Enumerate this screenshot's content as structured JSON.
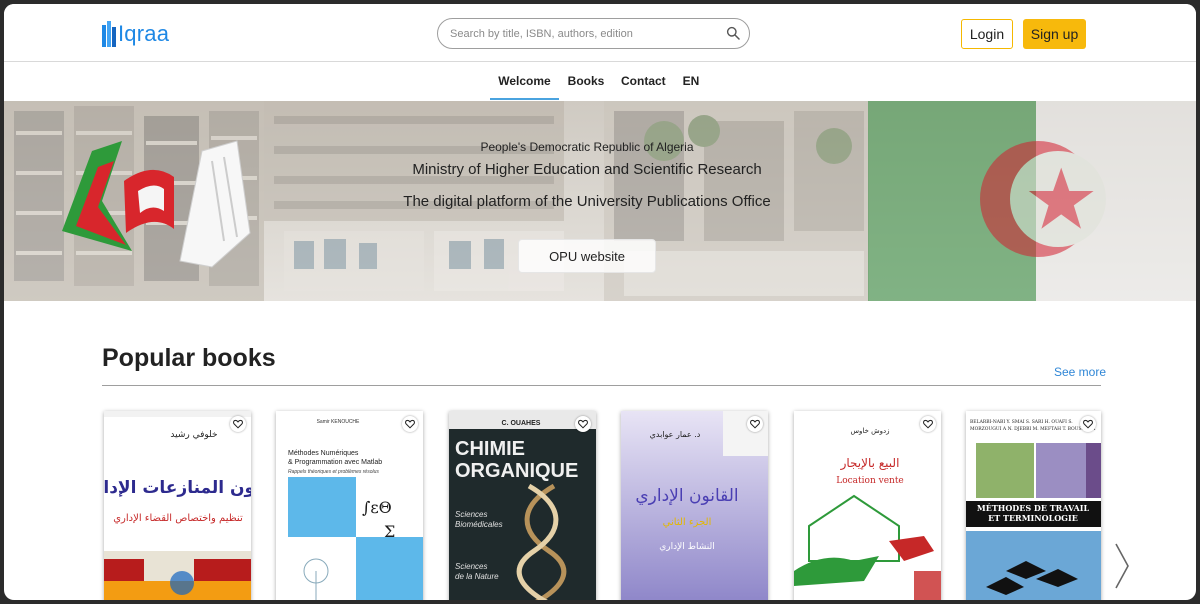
{
  "header": {
    "logo_text": "Iqraa",
    "search_placeholder": "Search by title, ISBN, authors, edition",
    "login_label": "Login",
    "signup_label": "Sign up"
  },
  "nav": {
    "items": [
      {
        "label": "Welcome",
        "active": true
      },
      {
        "label": "Books",
        "active": false
      },
      {
        "label": "Contact",
        "active": false
      },
      {
        "label": "EN",
        "active": false
      }
    ]
  },
  "banner": {
    "line1": "People's Democratic Republic of Algeria",
    "line2": "Ministry of Higher Education and Scientific Research",
    "line3": "The digital platform of the University Publications Office",
    "button_label": "OPU website"
  },
  "popular": {
    "title": "Popular books",
    "see_more_label": "See more",
    "books": [
      {
        "author": "خلوفي رشيد",
        "title": "قانون المنازعات الإدارية",
        "subtitle": "تنظيم واختصاص القضاء الإداري"
      },
      {
        "author": "Samir KENOUCHE",
        "title1": "Méthodes Numériques",
        "title2": "& Programmation avec Matlab",
        "subtitle": "Rappels théoriques et problèmes résolus"
      },
      {
        "author": "C. OUAHES",
        "title1": "CHIMIE",
        "title2": "ORGANIQUE",
        "sub1": "Sciences",
        "sub2": "Biomédicales",
        "sub3": "Sciences",
        "sub4": "de la Nature"
      },
      {
        "author": "د. عمار عوابدي",
        "title": "القانون الإداري",
        "part": "الجزء الثاني",
        "subtitle": "النشاط الإداري"
      },
      {
        "author": "زدوش خاوس",
        "title": "البيع بالإيجار",
        "subtitle": "Location vente"
      },
      {
        "authors1": "BELARBI-NABI Y.   SMAI S.   SARI H.   OUAFI S.",
        "authors2": "MORZOUGUI A N.   DJEBBI M.   MEFTAH T.   BOUSSOUA",
        "title1": "MÉTHODES DE TRAVAIL",
        "title2": "ET TERMINOLOGIE"
      }
    ]
  },
  "colors": {
    "brand_blue": "#1e88e5",
    "accent_yellow": "#f7b90c",
    "link_blue": "#2f86d6"
  },
  "icons": {
    "search": "search-icon",
    "favorite": "heart-icon",
    "next": "chevron-right-icon",
    "logo": "book-logo-icon"
  }
}
